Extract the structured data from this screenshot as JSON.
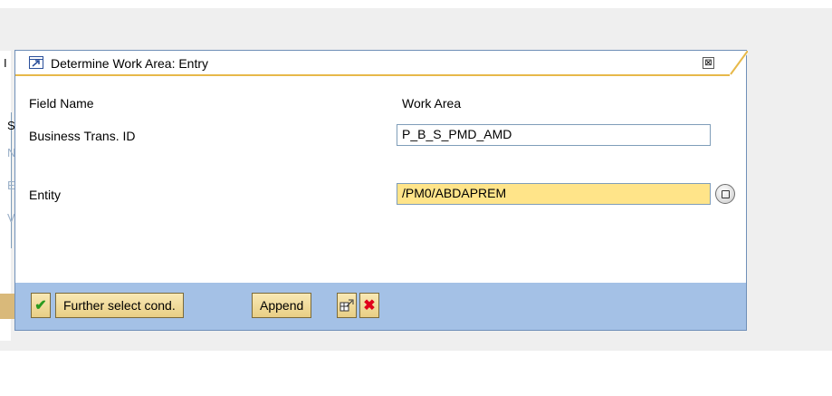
{
  "background": {
    "fragment_title_letter": "I",
    "fragment_letters": [
      "S",
      "N",
      "E",
      "V"
    ]
  },
  "dialog": {
    "title": "Determine Work Area: Entry",
    "close_glyph": "⊠",
    "header_field_name": "Field Name",
    "header_work_area": "Work Area",
    "rows": [
      {
        "label": "Business Trans. ID",
        "value": "P_B_S_PMD_AMD",
        "required": false
      },
      {
        "label": "Entity",
        "value": "/PM0/ABDAPREM",
        "required": true
      }
    ]
  },
  "toolbar": {
    "continue_glyph": "✔",
    "further_select_label": "Further select cond.",
    "append_label": "Append",
    "multiple_selection_icon": "multiple-selection-icon",
    "cancel_glyph": "✖"
  },
  "colors": {
    "toolbar_bg": "#a4c1e6",
    "title_accent": "#e7b94a",
    "required_field": "#ffe489",
    "cancel_red": "#e0001a",
    "continue_green": "#2a9a1f"
  }
}
